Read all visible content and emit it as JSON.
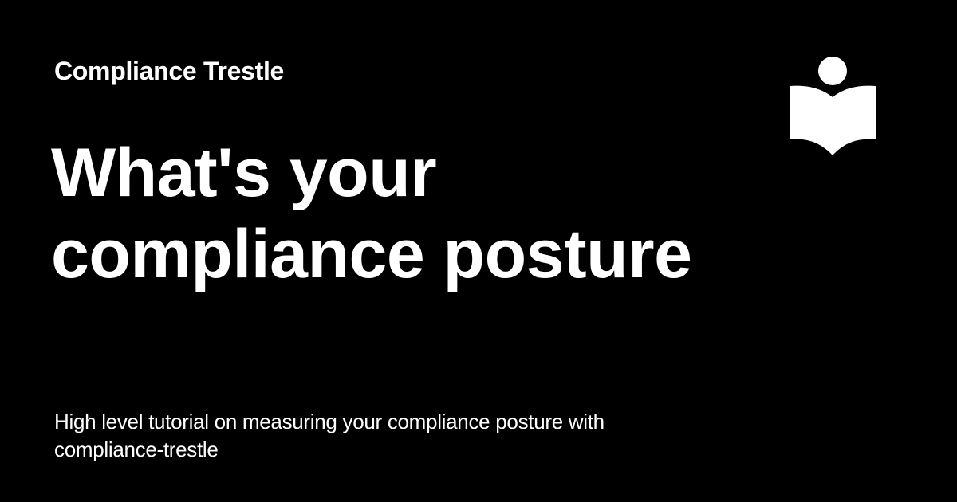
{
  "site": {
    "name": "Compliance Trestle",
    "logo_icon": "reader-book-icon"
  },
  "page": {
    "title": "What's your compliance posture",
    "description": "High level tutorial on measuring your compliance posture with compliance-trestle"
  },
  "colors": {
    "background": "#000000",
    "foreground": "#ffffff"
  }
}
